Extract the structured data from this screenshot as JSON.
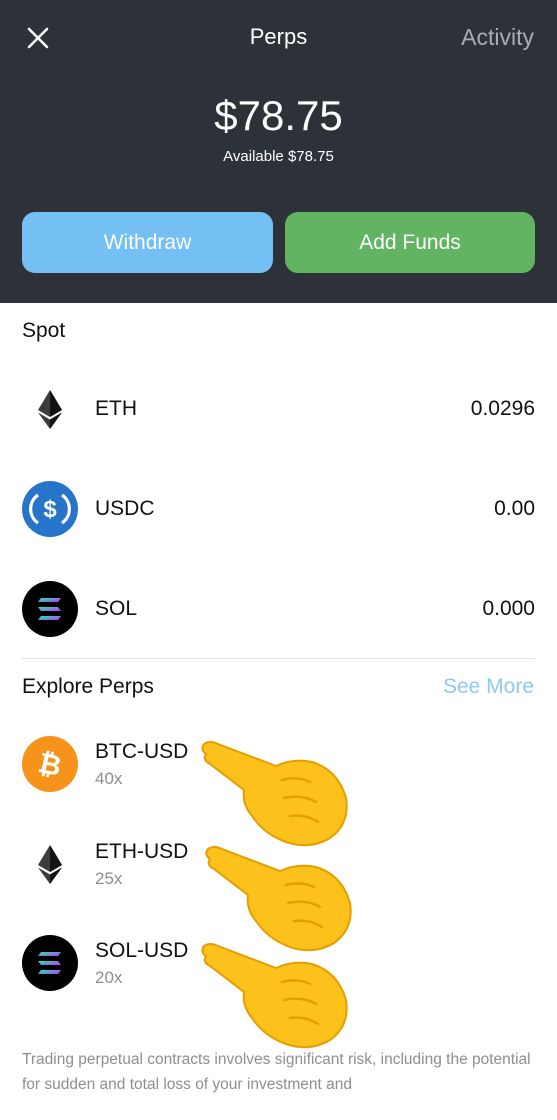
{
  "header": {
    "title": "Perps",
    "activity_label": "Activity",
    "balance": "$78.75",
    "available": "Available $78.75",
    "withdraw_label": "Withdraw",
    "add_funds_label": "Add Funds"
  },
  "spot": {
    "label": "Spot",
    "items": [
      {
        "symbol": "ETH",
        "amount": "0.0296",
        "icon": "eth-icon"
      },
      {
        "symbol": "USDC",
        "amount": "0.00",
        "icon": "usdc-icon"
      },
      {
        "symbol": "SOL",
        "amount": "0.000",
        "icon": "sol-icon"
      }
    ]
  },
  "explore": {
    "label": "Explore Perps",
    "see_more_label": "See More",
    "items": [
      {
        "pair": "BTC-USD",
        "leverage": "40x",
        "icon": "btc-icon"
      },
      {
        "pair": "ETH-USD",
        "leverage": "25x",
        "icon": "eth-icon"
      },
      {
        "pair": "SOL-USD",
        "leverage": "20x",
        "icon": "sol-icon"
      }
    ]
  },
  "disclaimer": "Trading perpetual contracts involves significant risk, including the potential for sudden and total loss of your investment and",
  "colors": {
    "header_bg": "#2d3239",
    "withdraw": "#74c0f4",
    "add_funds": "#62b462",
    "link": "#8ccbec",
    "btc": "#f7931a",
    "usdc": "#2775ca"
  }
}
